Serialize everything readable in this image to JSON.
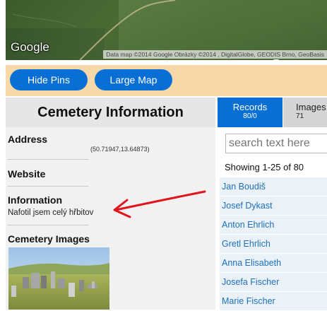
{
  "map": {
    "logo_text": "Google",
    "attribution": "Data map ©2014 Google Obrázky ©2014 , DigitalGlobe, GEODIS Brno, GeoBasis"
  },
  "toolbar": {
    "hide_pins_label": "Hide Pins",
    "large_map_label": "Large Map"
  },
  "info": {
    "title": "Cemetery Information",
    "address_heading": "Address",
    "address_coords": "(50.71947,13.64873)",
    "website_heading": "Website",
    "information_heading": "Information",
    "information_text": "Nafotil jsem celý hřbitov",
    "images_heading": "Cemetery Images"
  },
  "tabs": {
    "records": {
      "label": "Records",
      "count": "80/0"
    },
    "images": {
      "label": "Images",
      "count": "71"
    }
  },
  "search": {
    "placeholder": "search text here"
  },
  "results": {
    "showing": "Showing 1-25 of 80",
    "records": [
      "Jan Boudiš",
      "Josef Dykast",
      "Anton Ehrlich",
      "Gretl Ehrlich",
      "Anna Elisabeth",
      "Josefa Fischer",
      "Marie Fischer"
    ]
  },
  "colors": {
    "accent_blue": "#0a6fd4",
    "button_bar": "#f7d8a9",
    "annotation_arrow": "#e0141c"
  }
}
